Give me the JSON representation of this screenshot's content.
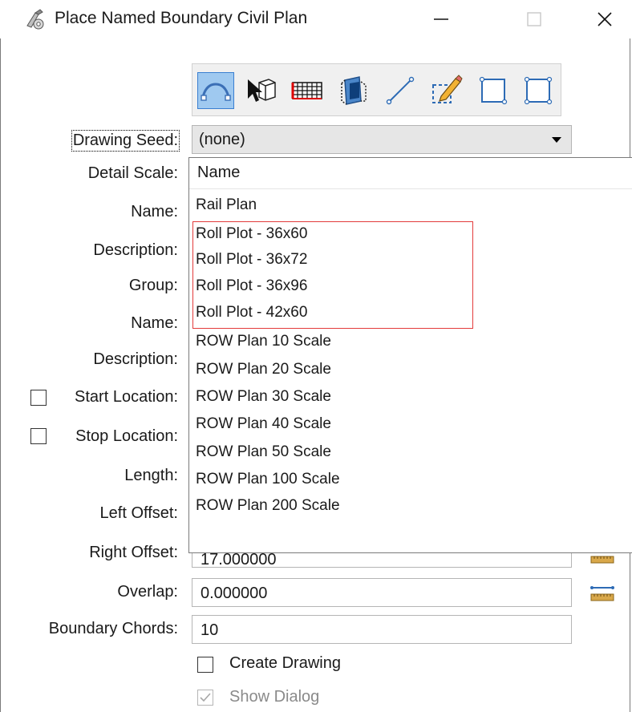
{
  "window": {
    "title": "Place Named Boundary Civil Plan",
    "minimize_glyph": "—",
    "maximize_glyph": "☐",
    "close_glyph": "✕"
  },
  "toolbar": {
    "tools": [
      {
        "name": "civil-plan-tool-icon",
        "active": true
      },
      {
        "name": "select-element-tool-icon",
        "active": false
      },
      {
        "name": "grid-tool-icon",
        "active": false
      },
      {
        "name": "view-volume-tool-icon",
        "active": false
      },
      {
        "name": "line-tool-icon",
        "active": false
      },
      {
        "name": "edit-shape-tool-icon",
        "active": false
      },
      {
        "name": "rectangle-tool-icon",
        "active": false
      },
      {
        "name": "shape-tool-icon",
        "active": false
      }
    ]
  },
  "form": {
    "drawing_seed_label": "Drawing Seed:",
    "drawing_seed_value": "(none)",
    "detail_scale_label": "Detail Scale:",
    "name_label": "Name:",
    "description_label": "Description:",
    "group_label": "Group:",
    "name2_label": "Name:",
    "description2_label": "Description:",
    "start_location_label": "Start Location:",
    "stop_location_label": "Stop Location:",
    "length_label": "Length:",
    "left_offset_label": "Left Offset:",
    "right_offset_label": "Right Offset:",
    "right_offset_value": "17.000000",
    "overlap_label": "Overlap:",
    "overlap_value": "0.000000",
    "boundary_chords_label": "Boundary Chords:",
    "boundary_chords_value": "10",
    "create_drawing_label": "Create Drawing",
    "show_dialog_label": "Show Dialog",
    "show_dialog_checked": true
  },
  "dropdown": {
    "header": "Name",
    "items": [
      "Rail Plan",
      "Roll Plot - 36x60",
      "Roll Plot - 36x72",
      "Roll Plot - 36x96",
      "Roll Plot - 42x60",
      "ROW Plan 10 Scale",
      "ROW Plan 20 Scale",
      "ROW Plan 30 Scale",
      "ROW Plan 40 Scale",
      "ROW Plan 50 Scale",
      "ROW Plan 100 Scale",
      "ROW Plan 200 Scale"
    ],
    "highlight_color": "#e33b3b"
  },
  "colors": {
    "accent": "#3a7fd1",
    "active_tool_bg": "#9fc9f0",
    "toolbar_bg": "#f0f0f0"
  }
}
